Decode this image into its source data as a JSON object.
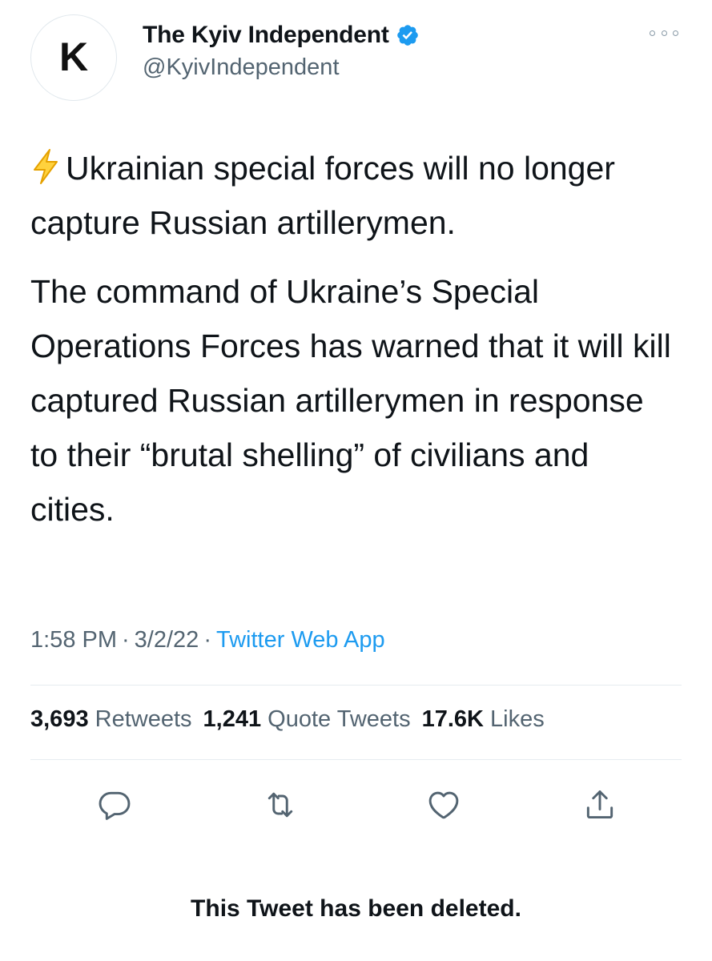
{
  "account": {
    "avatar_letter": "K",
    "display_name": "The Kyiv Independent",
    "handle": "@KyivIndependent",
    "verified": true
  },
  "tweet": {
    "emoji_icon": "lightning-bolt-icon",
    "paragraph_1": "Ukrainian special forces will no longer capture Russian artillerymen.",
    "paragraph_2": "The command of Ukraine’s Special Operations Forces has warned that it will kill captured Russian artillerymen in response to their “brutal shelling” of civilians and cities.",
    "time": "1:58 PM",
    "date": "3/2/22",
    "source": "Twitter Web App"
  },
  "stats": {
    "retweets_count": "3,693",
    "retweets_label": "Retweets",
    "quotes_count": "1,241",
    "quotes_label": "Quote Tweets",
    "likes_count": "17.6K",
    "likes_label": "Likes"
  },
  "actions": {
    "reply_icon": "reply-icon",
    "retweet_icon": "retweet-icon",
    "like_icon": "heart-icon",
    "share_icon": "share-icon"
  },
  "notice": {
    "text": "This Tweet has been deleted."
  },
  "colors": {
    "text": "#0f1419",
    "secondary": "#536471",
    "link": "#1d9bf0",
    "verified": "#1d9bf0",
    "bolt": "#f5b400",
    "divider": "#e6ecf0"
  }
}
